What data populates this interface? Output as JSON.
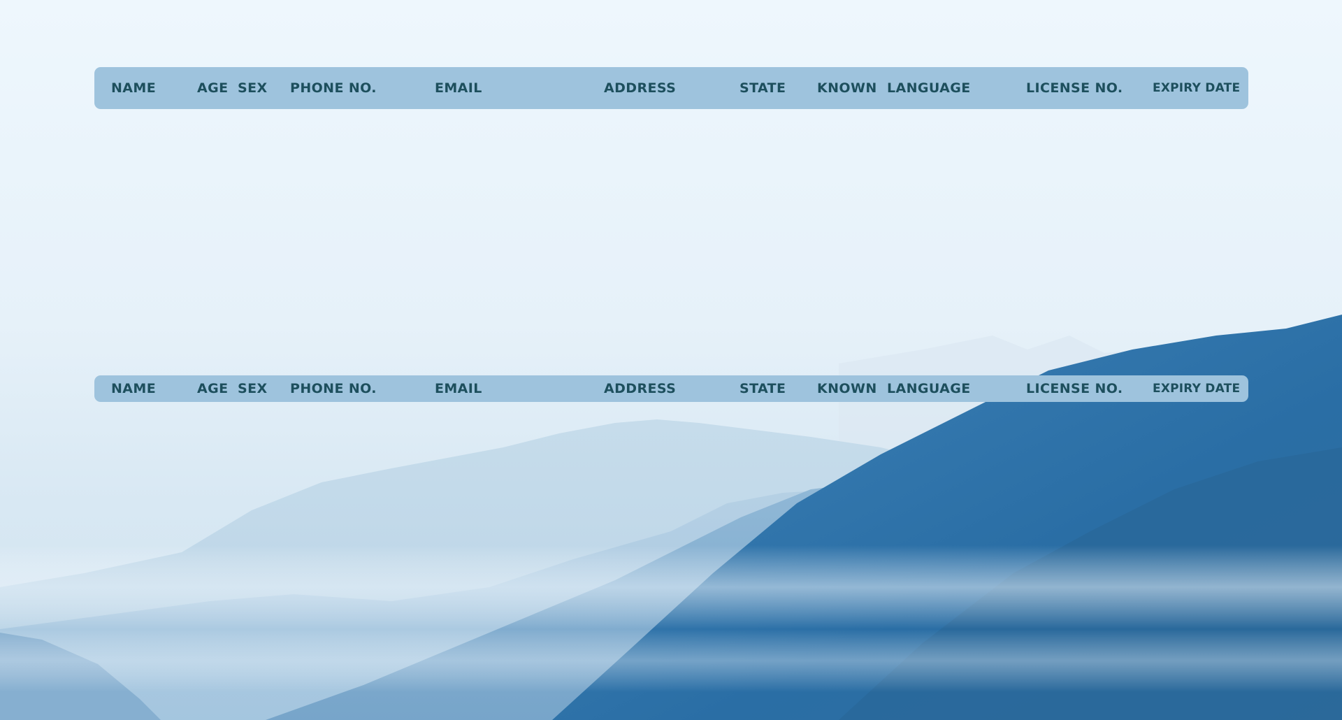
{
  "tables": [
    {
      "id": "top",
      "columns": [
        "NAME",
        "AGE",
        "SEX",
        "PHONE NO.",
        "EMAIL",
        "ADDRESS",
        "STATE",
        "KNOWN",
        "LANGUAGE",
        "LICENSE NO.",
        "EXPIRY DATE"
      ]
    },
    {
      "id": "bottom",
      "columns": [
        "NAME",
        "AGE",
        "SEX",
        "PHONE NO.",
        "EMAIL",
        "ADDRESS",
        "STATE",
        "KNOWN",
        "LANGUAGE",
        "LICENSE NO.",
        "EXPIRY DATE"
      ]
    }
  ],
  "colors": {
    "header_bg": "#9ec3dd",
    "header_text": "#1d4f5d",
    "sky": "#eef7fd",
    "mountain_dark": "#2f6fa3"
  },
  "background": {
    "image_name": "misty-blue-mountains"
  }
}
